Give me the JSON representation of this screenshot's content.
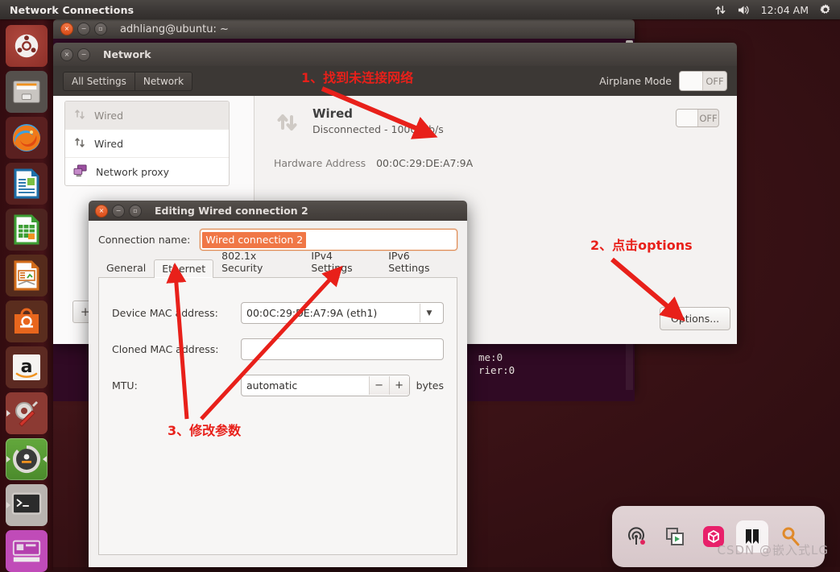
{
  "top_panel": {
    "title": "Network Connections",
    "clock": "12:04 AM",
    "icons": [
      "sync-icon",
      "volume-icon",
      "gear-icon"
    ]
  },
  "launcher": {
    "items": [
      {
        "name": "ubuntu-dash-icon",
        "label": "Dash home"
      },
      {
        "name": "files-icon",
        "label": "Files"
      },
      {
        "name": "firefox-icon",
        "label": "Firefox Web Browser"
      },
      {
        "name": "libreoffice-writer-icon",
        "label": "LibreOffice Writer"
      },
      {
        "name": "libreoffice-calc-icon",
        "label": "LibreOffice Calc"
      },
      {
        "name": "libreoffice-impress-icon",
        "label": "LibreOffice Impress"
      },
      {
        "name": "software-center-icon",
        "label": "Ubuntu Software Center"
      },
      {
        "name": "amazon-icon",
        "label": "Amazon"
      },
      {
        "name": "system-settings-icon",
        "label": "System Settings"
      },
      {
        "name": "software-updater-icon",
        "label": "Software Updater"
      },
      {
        "name": "terminal-icon",
        "label": "Terminal"
      },
      {
        "name": "workspace-switcher-icon",
        "label": "Workspace Switcher"
      }
    ]
  },
  "terminal_window": {
    "title": "adhliang@ubuntu: ~",
    "lines": [
      "me:0",
      "rier:0"
    ]
  },
  "network_window": {
    "title": "Network",
    "toolbar": {
      "all_settings": "All Settings",
      "network": "Network"
    },
    "airplane_mode": {
      "label": "Airplane Mode",
      "state": "OFF"
    },
    "sidebar": [
      {
        "label": "Wired",
        "icon": "wired-disconnected-icon",
        "selected": true
      },
      {
        "label": "Wired",
        "icon": "wired-icon",
        "selected": false
      },
      {
        "label": "Network proxy",
        "icon": "network-proxy-icon",
        "selected": false
      }
    ],
    "add_button": "+",
    "device": {
      "name": "Wired",
      "status": "Disconnected - 1000 Mb/s",
      "toggle_state": "OFF",
      "hardware_address_label": "Hardware Address",
      "hardware_address_value": "00:0C:29:DE:A7:9A"
    },
    "options_button": "Options..."
  },
  "edit_dialog": {
    "title": "Editing Wired connection 2",
    "connection_name_label": "Connection name:",
    "connection_name_value": "Wired connection 2",
    "tabs": [
      {
        "label": "General",
        "active": false
      },
      {
        "label": "Ethernet",
        "active": true
      },
      {
        "label": "802.1x Security",
        "active": false
      },
      {
        "label": "IPv4 Settings",
        "active": false
      },
      {
        "label": "IPv6 Settings",
        "active": false
      }
    ],
    "fields": {
      "device_mac_label": "Device MAC address:",
      "device_mac_value": "00:0C:29:DE:A7:9A (eth1)",
      "cloned_mac_label": "Cloned MAC address:",
      "cloned_mac_value": "",
      "mtu_label": "MTU:",
      "mtu_value": "automatic",
      "mtu_minus": "−",
      "mtu_plus": "+",
      "mtu_unit": "bytes"
    }
  },
  "annotations": [
    {
      "id": "step1",
      "text": "1、找到未连接网络"
    },
    {
      "id": "step2",
      "text": "2、点击options"
    },
    {
      "id": "step3",
      "text": "3、修改参数"
    }
  ],
  "dock": {
    "items": [
      "podcast-icon",
      "screen-record-icon",
      "package-icon",
      "ribbon-icon",
      "search-icon"
    ]
  },
  "watermark": "CSDN @嵌入式LG",
  "colors": {
    "accent_orange": "#f07746",
    "annotation_red": "#e8201a",
    "panel_dark": "#3b3735",
    "terminal_bg": "#300a24"
  }
}
